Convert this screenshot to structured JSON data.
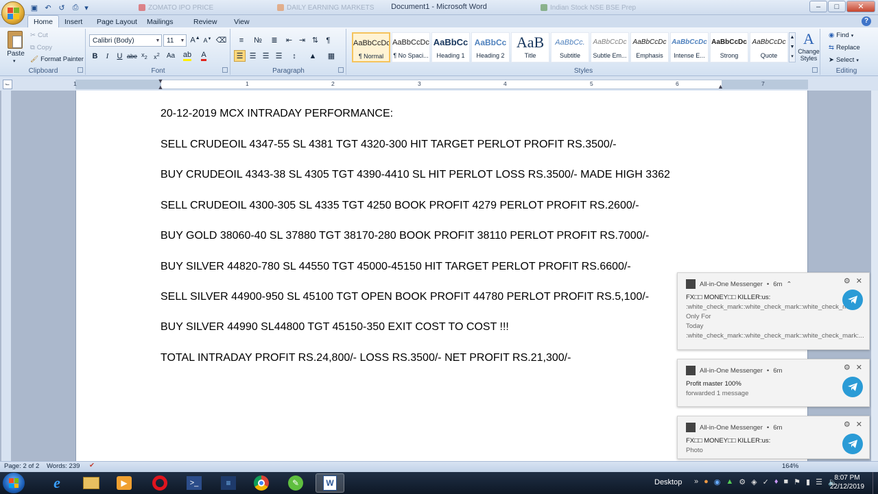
{
  "window": {
    "title": "Document1 - Microsoft Word",
    "browser_tabs": [
      "ZOMATO IPO PRICE",
      "DAILY EARNING MARKETS",
      "Indian Stock NSE BSE Prep"
    ]
  },
  "tabs": [
    "Home",
    "Insert",
    "Page Layout",
    "Mailings",
    "Review",
    "View"
  ],
  "active_tab": "Home",
  "clipboard": {
    "paste": "Paste",
    "cut": "Cut",
    "copy": "Copy",
    "format_painter": "Format Painter",
    "label": "Clipboard"
  },
  "font": {
    "family": "Calibri (Body)",
    "size": "11",
    "label": "Font"
  },
  "paragraph": {
    "label": "Paragraph"
  },
  "styles": {
    "label": "Styles",
    "items": [
      {
        "sample": "AaBbCcDc",
        "name": "¶ Normal"
      },
      {
        "sample": "AaBbCcDc",
        "name": "¶ No Spaci..."
      },
      {
        "sample": "AaBbCc",
        "name": "Heading 1"
      },
      {
        "sample": "AaBbCc",
        "name": "Heading 2"
      },
      {
        "sample": "AaB",
        "name": "Title"
      },
      {
        "sample": "AaBbCc.",
        "name": "Subtitle"
      },
      {
        "sample": "AaBbCcDc",
        "name": "Subtle Em..."
      },
      {
        "sample": "AaBbCcDc",
        "name": "Emphasis"
      },
      {
        "sample": "AaBbCcDc",
        "name": "Intense E..."
      },
      {
        "sample": "AaBbCcDc",
        "name": "Strong"
      },
      {
        "sample": "AaBbCcDc",
        "name": "Quote"
      }
    ],
    "change_styles": "Change Styles"
  },
  "editing": {
    "find": "Find",
    "replace": "Replace",
    "select": "Select",
    "label": "Editing"
  },
  "ruler": {
    "numbers": [
      "1",
      "1",
      "2",
      "3",
      "4",
      "5",
      "6",
      "7"
    ]
  },
  "document": {
    "lines": [
      "20-12-2019 MCX INTRADAY PERFORMANCE:",
      "SELL CRUDEOIL 4347-55 SL 4381 TGT 4320-300 HIT TARGET PERLOT PROFIT RS.3500/-",
      "BUY CRUDEOIL 4343-38 SL 4305 TGT 4390-4410 SL HIT PERLOT  LOSS RS.3500/-  MADE HIGH 3362",
      "SELL CRUDEOIL 4300-305 SL 4335 TGT 4250 BOOK PROFIT 4279 PERLOT PROFIT RS.2600/-",
      "BUY GOLD 38060-40 SL 37880 TGT 38170-280 BOOK PROFIT 38110 PERLOT PROFIT RS.7000/-",
      "BUY SILVER 44820-780 SL 44550 TGT 45000-45150 HIT TARGET PERLOT PROFIT RS.6600/-",
      "SELL SILVER 44900-950 SL 45100 TGT OPEN BOOK PROFIT 44780  PERLOT PROFIT RS.5,100/-",
      "BUY SILVER 44990 SL44800 TGT 45150-350 EXIT COST TO COST !!!",
      "TOTAL INTRADAY PROFIT RS.24,800/- LOSS RS.3500/- NET PROFIT RS.21,300/-"
    ]
  },
  "status": {
    "page": "Page: 2 of 2",
    "words": "Words: 239",
    "zoom": "164%"
  },
  "notifications": [
    {
      "app": "All-in-One Messenger",
      "time": "6m",
      "lines": [
        "FX□□ MONEY□□ KILLER:us:",
        ":white_check_mark::white_check_mark::white_check_mark: Only For",
        "Today :white_check_mark::white_check_mark::white_check_mark:..."
      ]
    },
    {
      "app": "All-in-One Messenger",
      "time": "6m",
      "lines": [
        "Profit master 100%",
        "forwarded 1 message"
      ]
    },
    {
      "app": "All-in-One Messenger",
      "time": "6m",
      "lines": [
        "FX□□ MONEY□□ KILLER:us:",
        "Photo"
      ]
    }
  ],
  "taskbar": {
    "desktop": "Desktop",
    "time": "8:07 PM",
    "date": "22/12/2019"
  }
}
